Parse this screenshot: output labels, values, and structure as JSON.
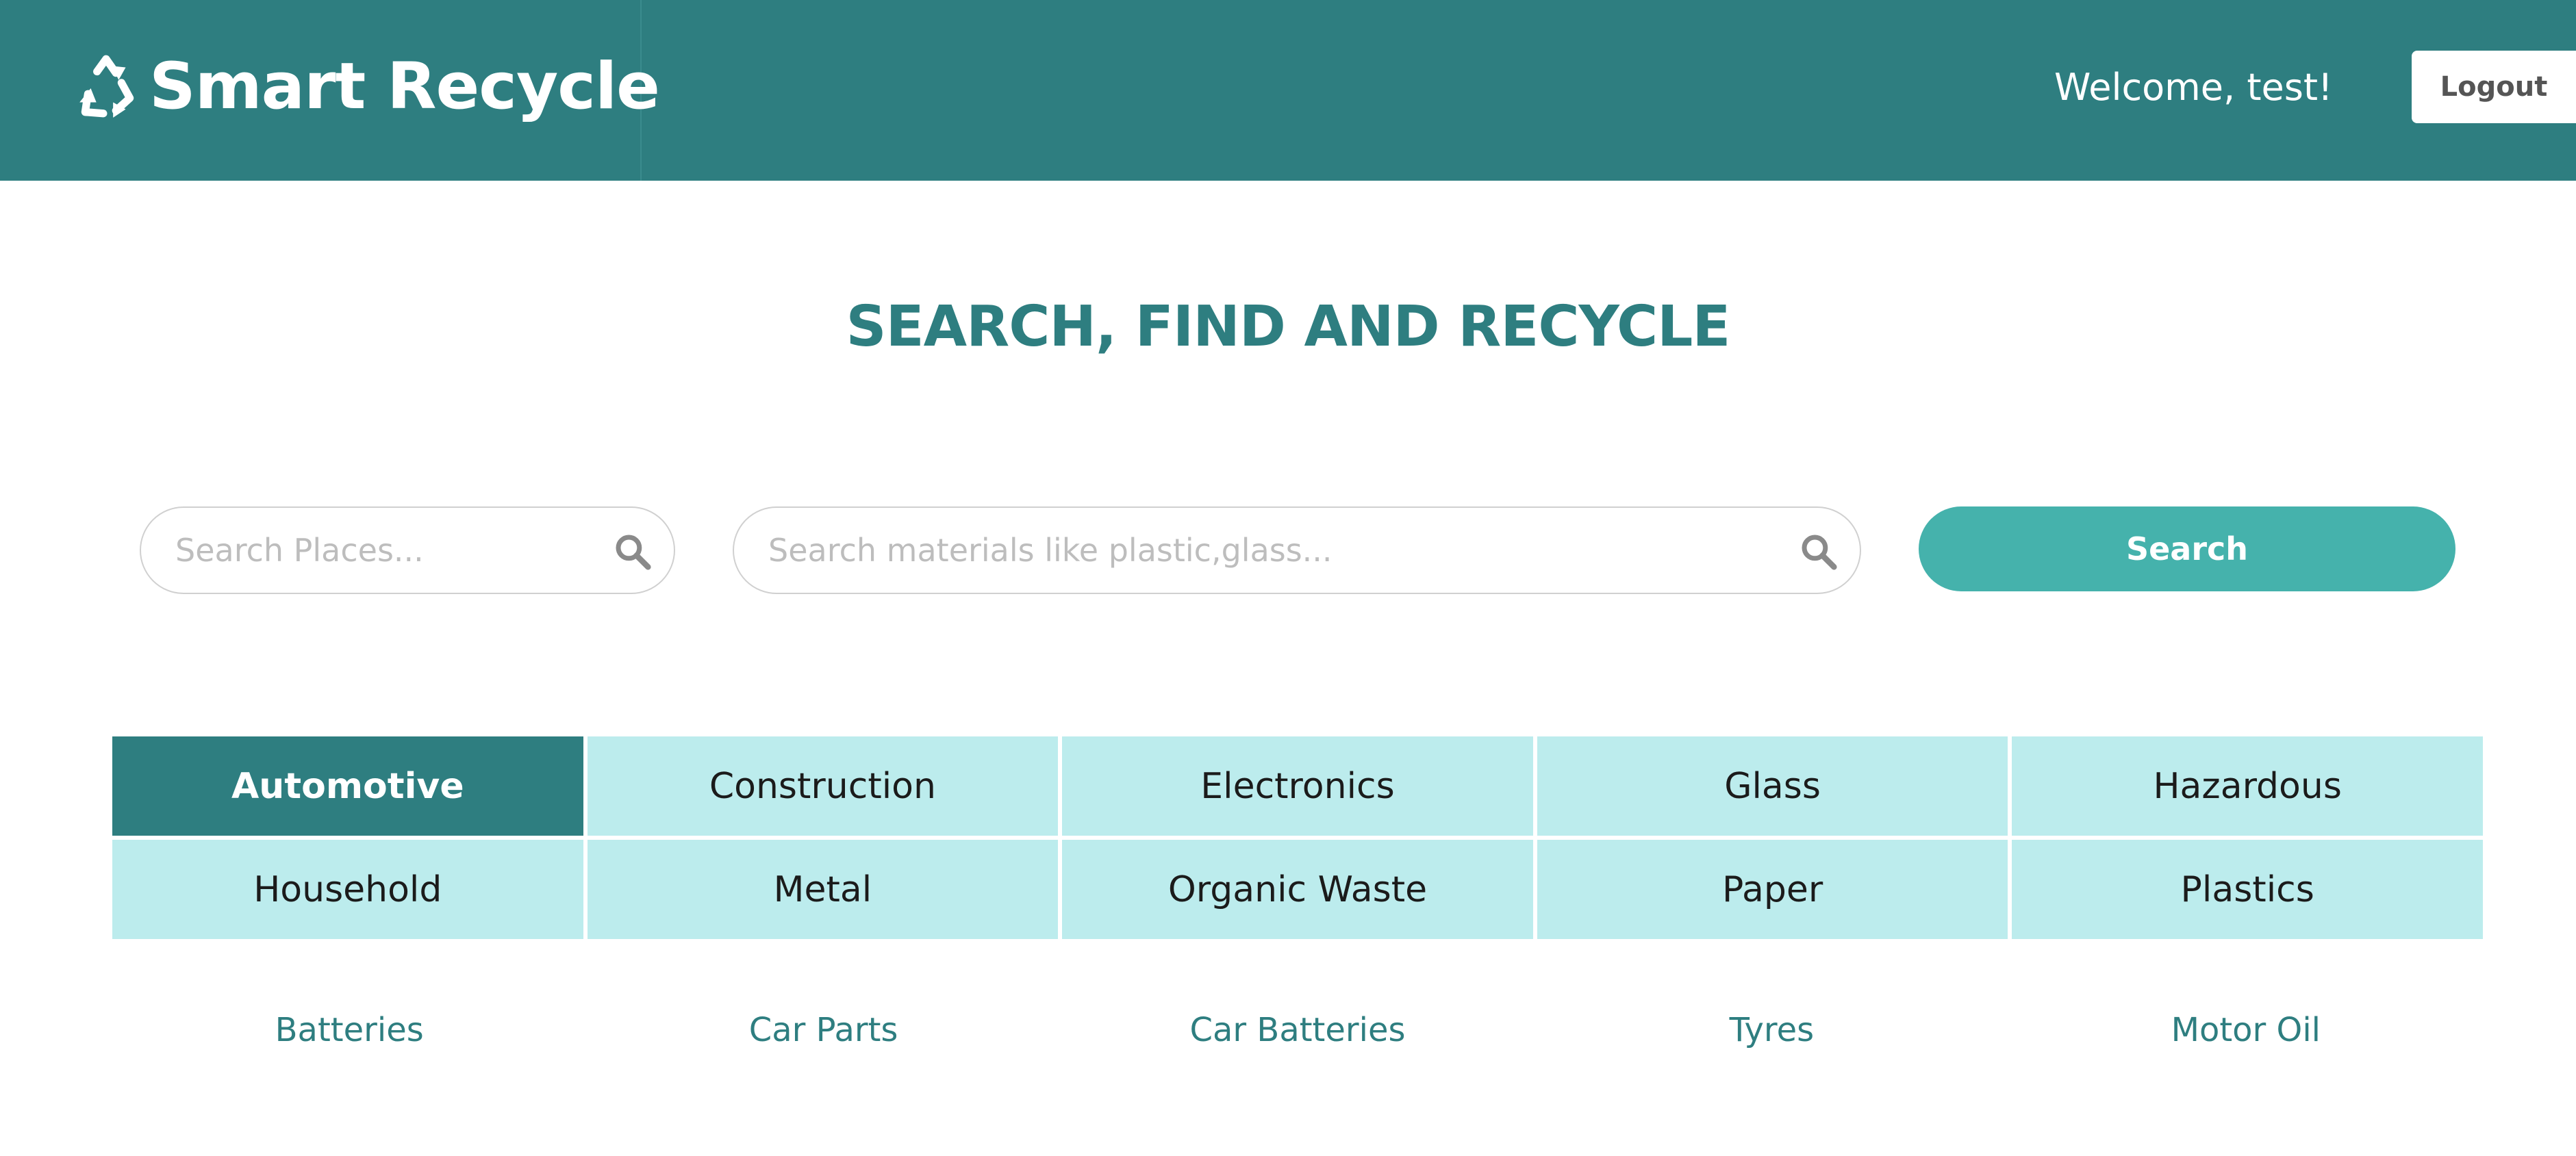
{
  "header": {
    "brand_name": "Smart Recycle",
    "brand_icon": "recycle-icon",
    "welcome_text": "Welcome, test!",
    "logout_label": "Logout"
  },
  "main": {
    "title": "SEARCH, FIND AND RECYCLE",
    "places_search": {
      "placeholder": "Search Places...",
      "value": "",
      "icon": "search-icon"
    },
    "materials_search": {
      "placeholder": "Search materials like plastic,glass...",
      "value": "",
      "icon": "search-icon"
    },
    "search_button_label": "Search"
  },
  "categories": [
    {
      "label": "Automotive",
      "active": true
    },
    {
      "label": "Construction",
      "active": false
    },
    {
      "label": "Electronics",
      "active": false
    },
    {
      "label": "Glass",
      "active": false
    },
    {
      "label": "Hazardous",
      "active": false
    },
    {
      "label": "Household",
      "active": false
    },
    {
      "label": "Metal",
      "active": false
    },
    {
      "label": "Organic Waste",
      "active": false
    },
    {
      "label": "Paper",
      "active": false
    },
    {
      "label": "Plastics",
      "active": false
    }
  ],
  "subcategories": [
    {
      "label": "Batteries"
    },
    {
      "label": "Car Parts"
    },
    {
      "label": "Car Batteries"
    },
    {
      "label": "Tyres"
    },
    {
      "label": "Motor Oil"
    }
  ],
  "colors": {
    "brand": "#2e7e80",
    "accent": "#45b2ac",
    "category_bg": "#bceced"
  }
}
